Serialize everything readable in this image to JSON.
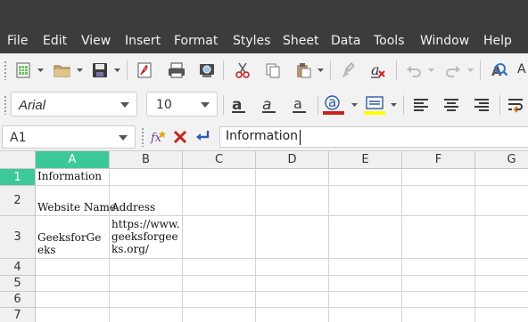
{
  "menubar": {
    "items": [
      "File",
      "Edit",
      "View",
      "Insert",
      "Format",
      "Styles",
      "Sheet",
      "Data",
      "Tools",
      "Window",
      "Help"
    ]
  },
  "toolbar_standard": {
    "icons": [
      "new-spreadsheet-icon",
      "open-folder-icon",
      "save-icon",
      "export-pdf-icon",
      "print-icon",
      "print-preview-icon",
      "cut-icon",
      "copy-icon",
      "paste-icon",
      "clone-formatting-icon",
      "clear-formatting-icon",
      "undo-icon",
      "redo-icon",
      "find-replace-icon"
    ],
    "partial_label": "A"
  },
  "toolbar_formatting": {
    "font_name": "Arial",
    "font_size": "10",
    "font_color": "#c9211e",
    "highlight_color": "#ffff00",
    "icons": [
      "bold-icon",
      "italic-icon",
      "underline-icon",
      "font-color-icon",
      "highlight-color-icon",
      "align-left-icon",
      "align-center-icon",
      "align-right-icon",
      "wrap-text-icon"
    ]
  },
  "formula_bar": {
    "name_box": "A1",
    "content": "Information"
  },
  "sheet": {
    "columns": [
      "A",
      "B",
      "C",
      "D",
      "E",
      "F",
      "G"
    ],
    "rows": [
      "1",
      "2",
      "3",
      "4",
      "5",
      "6",
      "7"
    ],
    "active_cell": "A1",
    "accent_color": "#3dc89a",
    "cells": {
      "A1": "Information",
      "A2": "Website Name",
      "B2": "Address",
      "A3": "GeeksforGeeks",
      "B3": "https://www.geeksforgeeks.org/"
    }
  }
}
